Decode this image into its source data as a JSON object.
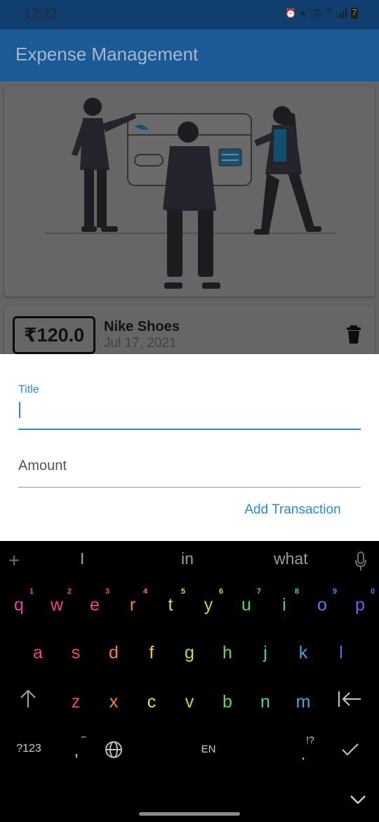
{
  "status_bar": {
    "time": "12:22",
    "net_top": "Vo8",
    "net_bottom": "LTE1",
    "net_gen": "4G",
    "battery": "7"
  },
  "app_bar": {
    "title": "Expense Management"
  },
  "transaction": {
    "amount": "₹120.0",
    "title": "Nike Shoes",
    "date": "Jul 17, 2021"
  },
  "form": {
    "title_label": "Title",
    "title_value": "",
    "amount_placeholder": "Amount",
    "submit_label": "Add Transaction"
  },
  "keyboard": {
    "suggestions": [
      "I",
      "in",
      "what"
    ],
    "row1": [
      {
        "k": "q",
        "n": "1",
        "c": "#e83fb0"
      },
      {
        "k": "w",
        "n": "2",
        "c": "#f03f8a"
      },
      {
        "k": "e",
        "n": "3",
        "c": "#f44a5b"
      },
      {
        "k": "r",
        "n": "4",
        "c": "#f7813d"
      },
      {
        "k": "t",
        "n": "5",
        "c": "#e8d83a"
      },
      {
        "k": "y",
        "n": "6",
        "c": "#a8e23d"
      },
      {
        "k": "u",
        "n": "7",
        "c": "#5ad85a"
      },
      {
        "k": "i",
        "n": "8",
        "c": "#3fcfc6"
      },
      {
        "k": "o",
        "n": "9",
        "c": "#4d86f0"
      },
      {
        "k": "p",
        "n": "0",
        "c": "#7a5af0"
      }
    ],
    "row2": [
      {
        "k": "a",
        "c": "#f03f8a"
      },
      {
        "k": "s",
        "c": "#f44a5b"
      },
      {
        "k": "d",
        "c": "#f7813d"
      },
      {
        "k": "f",
        "c": "#f1c43a"
      },
      {
        "k": "g",
        "c": "#b6e03d"
      },
      {
        "k": "h",
        "c": "#5ad85a"
      },
      {
        "k": "j",
        "c": "#3fd6a0"
      },
      {
        "k": "k",
        "c": "#3fa7e0"
      },
      {
        "k": "l",
        "c": "#4d6ef0"
      }
    ],
    "row3": [
      {
        "k": "z",
        "c": "#f44a5b"
      },
      {
        "k": "x",
        "c": "#f7813d"
      },
      {
        "k": "c",
        "c": "#e8e23a"
      },
      {
        "k": "v",
        "c": "#a8e23d"
      },
      {
        "k": "b",
        "c": "#5ad85a"
      },
      {
        "k": "n",
        "c": "#3fd6b0"
      },
      {
        "k": "m",
        "c": "#3fa7e0"
      }
    ],
    "symbols_label": "?123",
    "comma": ",",
    "lang_label": "EN",
    "period": ".",
    "punct_hint": "!?",
    "comma_hint": "\"\""
  }
}
